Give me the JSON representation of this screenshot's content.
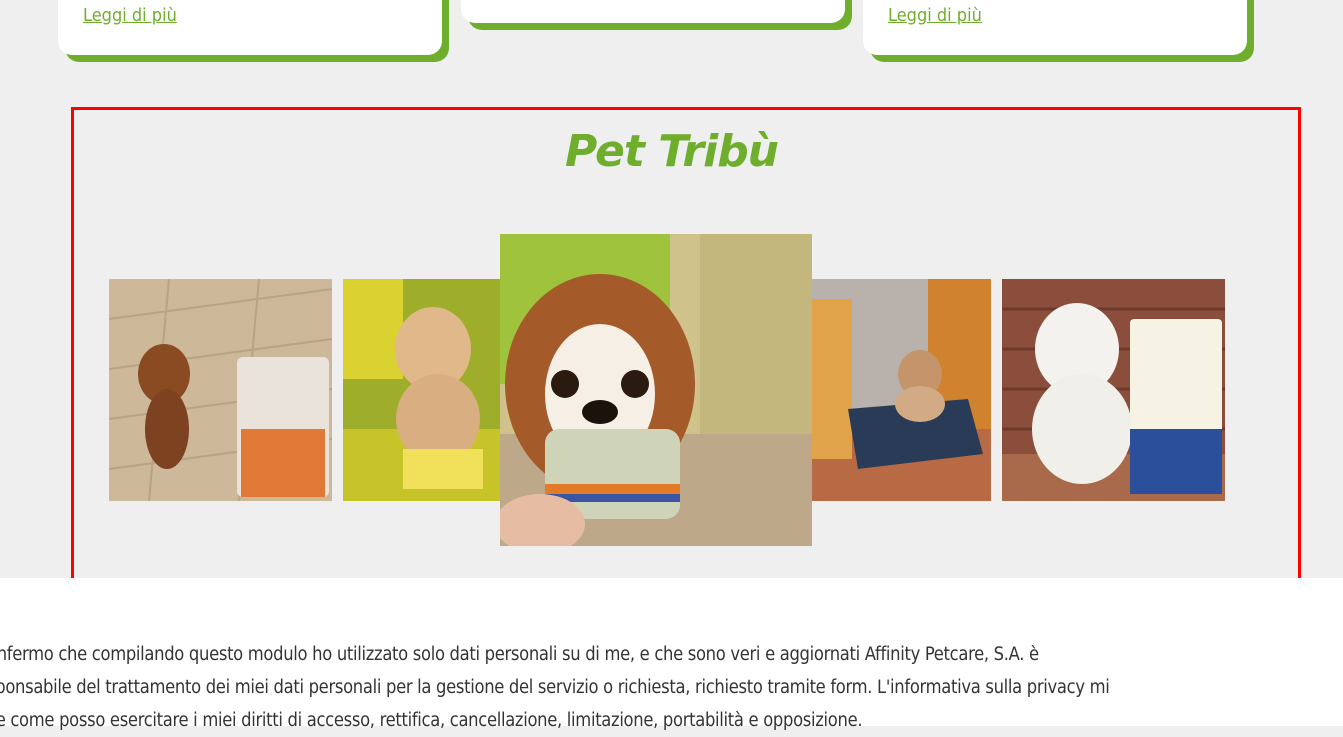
{
  "cards": {
    "left_link": "Leggi di più",
    "right_link": "Leggi di più"
  },
  "gallery": {
    "title": "Pet Tribù",
    "photos": [
      {
        "subject": "dachshund beside Trainer Sensitive bag"
      },
      {
        "subject": "poodle on Trainer food bags"
      },
      {
        "subject": "cavalier spaniel holding Trainer can"
      },
      {
        "subject": "bulldog on pet bed beside Trainer bag"
      },
      {
        "subject": "white maltese beside Trainer bag"
      }
    ]
  },
  "consent": {
    "line1": "onfermo che compilando questo modulo ho utilizzato solo dati personali su di me, e che sono veri e aggiornati Affinity Petcare, S.A. è",
    "line2": "sponsabile del trattamento dei miei dati personali per la gestione del servizio o richiesta, richiesto tramite form. L'informativa sulla privacy mi",
    "line3": "ce come posso esercitare i miei diritti di accesso, rettifica, cancellazione, limitazione, portabilità e opposizione."
  },
  "colors": {
    "accent": "#6fae2d",
    "highlight": "#ff0000",
    "background": "#efefef"
  }
}
